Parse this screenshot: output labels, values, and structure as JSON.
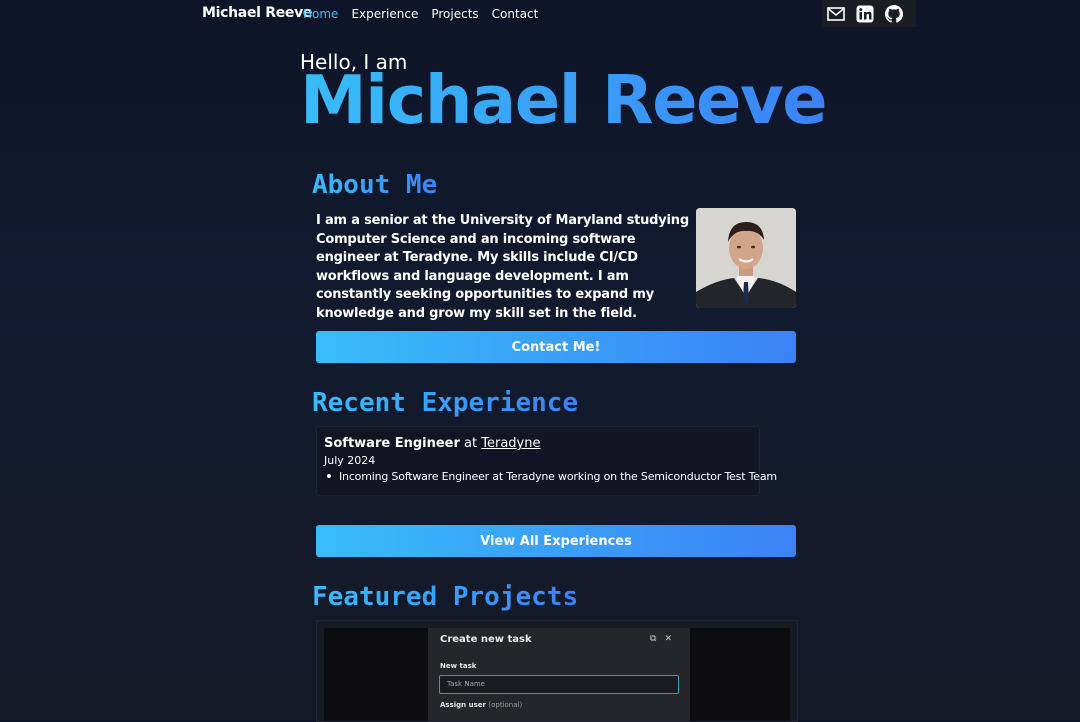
{
  "nav": {
    "brand": "Michael Reeve",
    "links": [
      "Home",
      "Experience",
      "Projects",
      "Contact"
    ],
    "active": "Home",
    "icons": [
      "mail-icon",
      "linkedin-icon",
      "github-icon"
    ]
  },
  "hero": {
    "greeting": "Hello, I am",
    "name": "Michael Reeve"
  },
  "about": {
    "title": "About Me",
    "text": "I am a senior at the University of Maryland studying Computer Science and an incoming software engineer at Teradyne. My skills include CI/CD workflows and language development. I am constantly seeking opportunities to expand my knowledge and grow my skill set in the field.",
    "contact_button": "Contact Me!"
  },
  "experience": {
    "title": "Recent Experience",
    "role": "Software Engineer",
    "at": "at",
    "company": "Teradyne",
    "date": "July 2024",
    "bullet": "Incoming Software Engineer at Teradyne working on the Semiconductor Test Team",
    "view_all_button": "View All Experiences"
  },
  "projects": {
    "title": "Featured Projects",
    "preview": {
      "dialog_title": "Create new task",
      "new_task_label": "New task",
      "task_placeholder": "Task Name",
      "assign_label": "Assign user",
      "assign_optional": "(optional)"
    }
  },
  "colors": {
    "accent_start": "#38bdf8",
    "accent_end": "#3b82f6",
    "background": "#0e1528"
  }
}
